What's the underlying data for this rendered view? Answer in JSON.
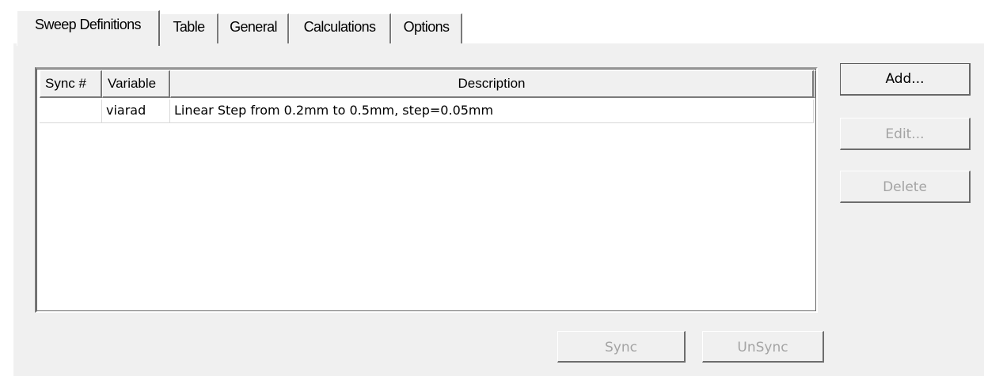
{
  "tabs": [
    {
      "label": "Sweep Definitions",
      "active": true
    },
    {
      "label": "Table",
      "active": false
    },
    {
      "label": "General",
      "active": false
    },
    {
      "label": "Calculations",
      "active": false
    },
    {
      "label": "Options",
      "active": false
    }
  ],
  "table": {
    "columns": [
      "Sync #",
      "Variable",
      "Description"
    ],
    "rows": [
      {
        "sync": "",
        "variable": "viarad",
        "description": "Linear Step from 0.2mm to 0.5mm, step=0.05mm"
      }
    ]
  },
  "buttons": {
    "add": "Add...",
    "edit": "Edit...",
    "delete": "Delete",
    "sync": "Sync",
    "unsync": "UnSync"
  },
  "colors": {
    "background": "#f0f0f0",
    "disabled_text": "#a4a4a4"
  }
}
